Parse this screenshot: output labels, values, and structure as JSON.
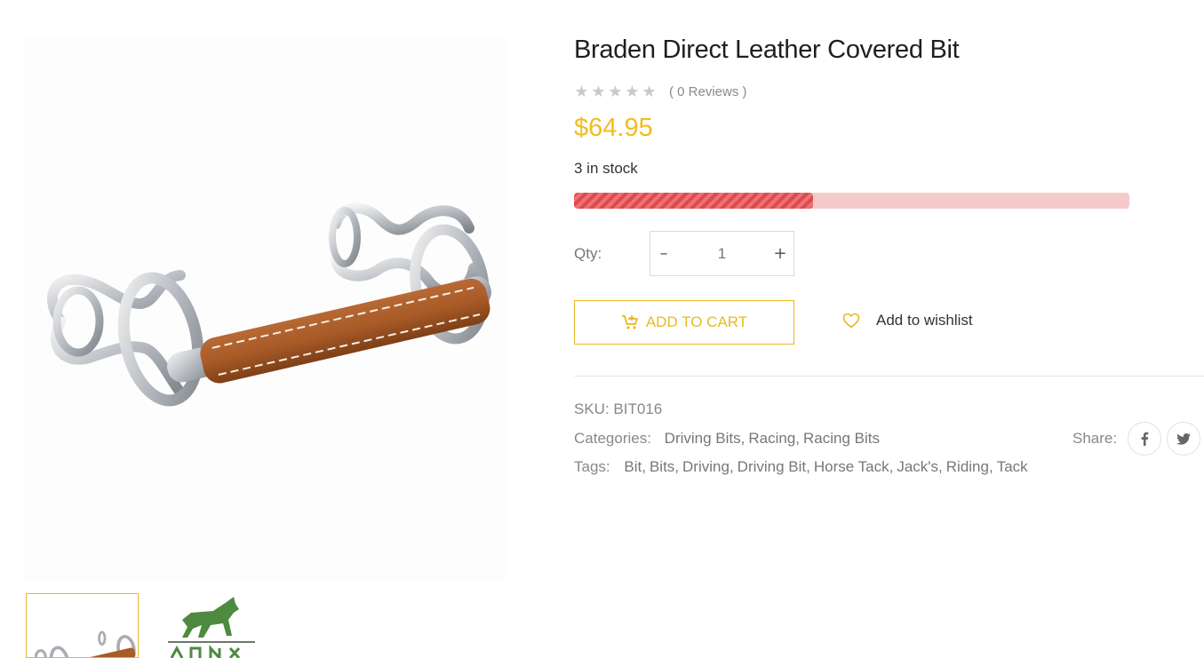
{
  "gallery": {
    "main_image_alt": "product-image-leather-covered-bit",
    "thumbnails": [
      {
        "name": "thumb-bit-photo"
      },
      {
        "name": "thumb-brand-logo"
      }
    ]
  },
  "product": {
    "title": "Braden Direct Leather Covered Bit",
    "rating": {
      "stars": 0,
      "max_stars": 5,
      "reviews_text": "( 0 Reviews )"
    },
    "price": "$64.95",
    "stock_text": "3 in stock",
    "stock_level_fraction": 0.43
  },
  "purchase": {
    "qty_label": "Qty:",
    "qty_value": "1",
    "minus": "–",
    "plus": "+",
    "add_to_cart": "ADD TO CART",
    "wishlist": "Add to wishlist"
  },
  "meta": {
    "sku_label": "SKU:",
    "sku_value": "BIT016",
    "categories_label": "Categories:",
    "categories": [
      "Driving Bits",
      "Racing",
      "Racing Bits"
    ],
    "tags_label": "Tags:",
    "tags": [
      "Bit",
      "Bits",
      "Driving",
      "Driving Bit",
      "Horse Tack",
      "Jack's",
      "Riding",
      "Tack"
    ],
    "share_label": "Share:",
    "share_icons": [
      "facebook-icon",
      "twitter-icon"
    ]
  },
  "colors": {
    "accent": "#e8b923",
    "price": "#f2bd1b",
    "stock_fill": "#e0494c",
    "stock_track": "#f6caca",
    "star_empty": "#c9c9c9"
  }
}
